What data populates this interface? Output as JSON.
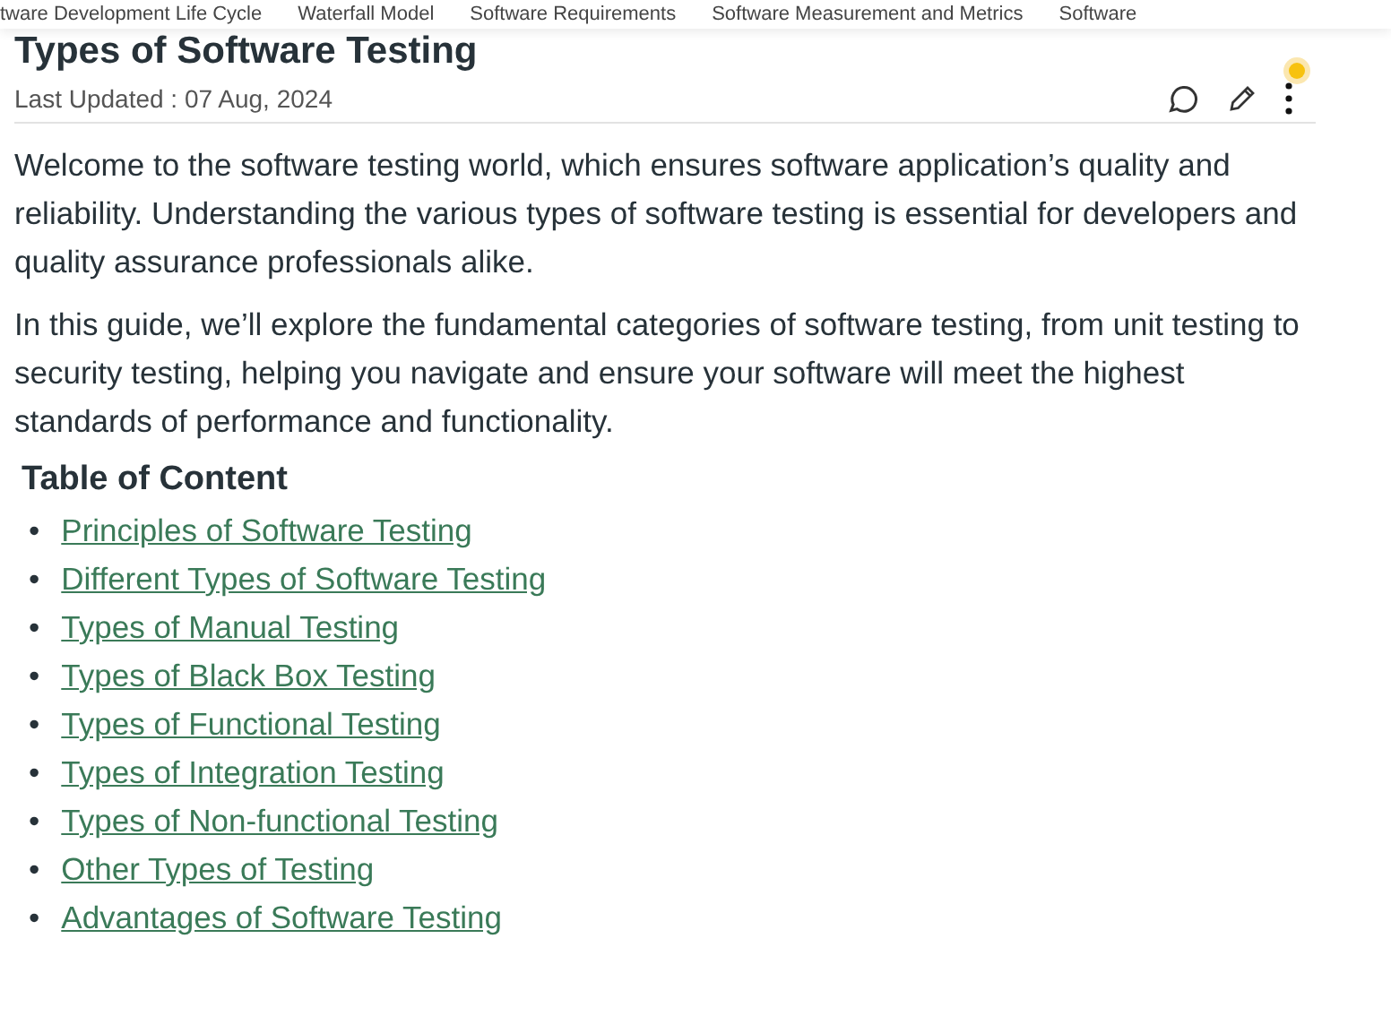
{
  "nav": [
    "tware Development Life Cycle",
    "Waterfall Model",
    "Software Requirements",
    "Software Measurement and Metrics",
    "Software"
  ],
  "article": {
    "title": "Types of Software Testing",
    "last_updated": "Last Updated : 07 Aug, 2024",
    "notification_dot": true,
    "paragraphs": [
      "Welcome to the software testing world, which ensures software application’s quality and reliability. Understanding the various types of software testing is essential for developers and quality assurance professionals alike.",
      "In this guide, we’ll explore the fundamental categories of software testing, from unit testing to security testing, helping you navigate and ensure your software will meet the highest standards of performance and functionality."
    ],
    "toc_heading": "Table of Content",
    "toc": [
      {
        "marker": "•",
        "text": "Principles of Software Testing"
      },
      {
        "marker": "•",
        "text": "Different Types of Software Testing"
      },
      {
        "marker": "•",
        "text": "Types of Manual Testing"
      },
      {
        "marker": "•",
        "text": "Types of Black Box Testing"
      },
      {
        "marker": "•",
        "text": "Types of Functional Testing"
      },
      {
        "marker": "•",
        "text": "Types of Integration Testing"
      },
      {
        "marker": "•",
        "text": "Types of Non-functional Testing"
      },
      {
        "marker": "•",
        "text": "Other Types of Testing"
      },
      {
        "marker": "•",
        "text": "Advantages of Software Testing"
      }
    ]
  }
}
